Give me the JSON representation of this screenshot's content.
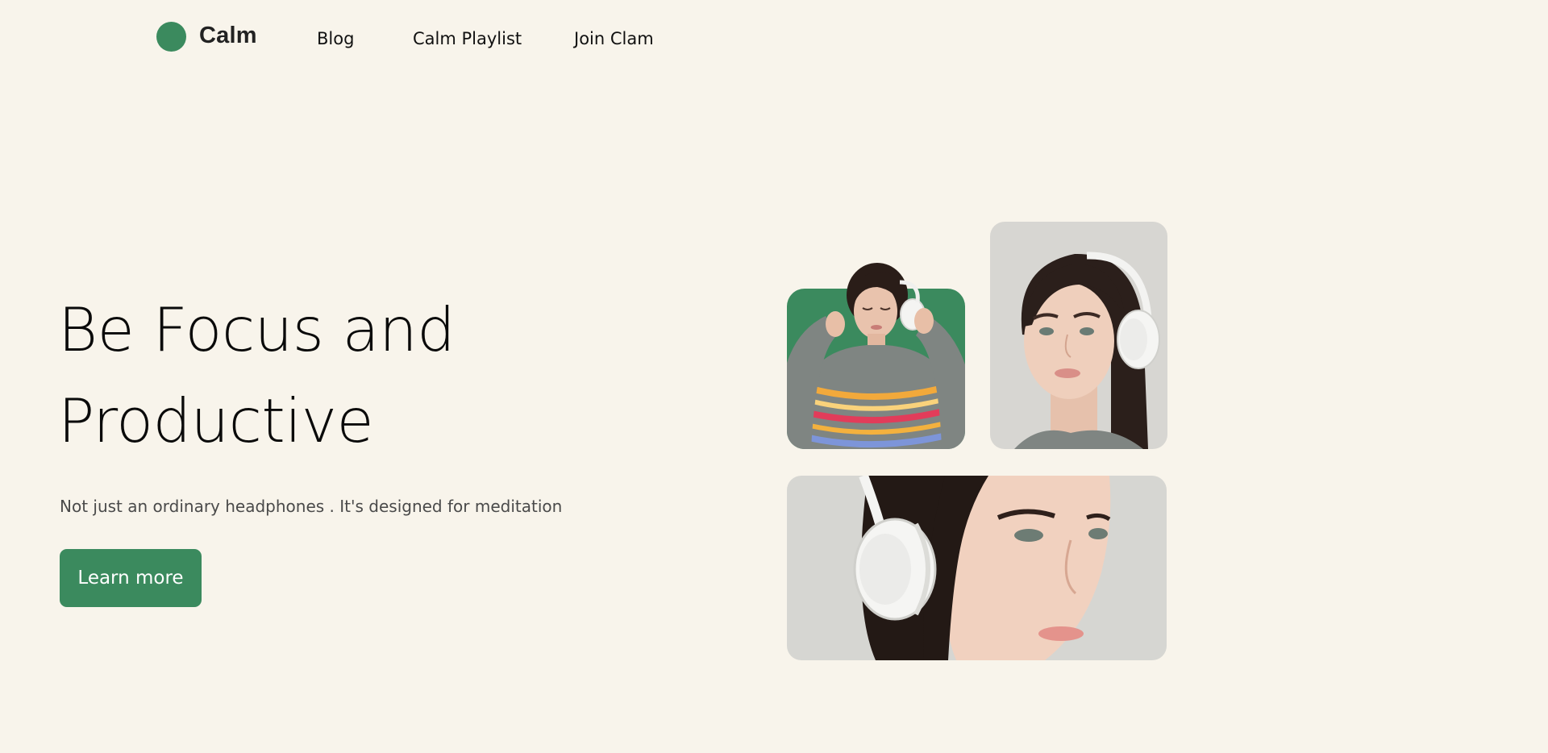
{
  "brand": {
    "name": "Calm",
    "accent": "#3b8a5e",
    "background": "#f8f4eb"
  },
  "nav": {
    "blog": "Blog",
    "playlist": "Calm Playlist",
    "join": "Join Clam"
  },
  "hero": {
    "title_line1": "Be Focus and",
    "title_line2": "Productive",
    "subtitle": "Not just an ordinary headphones . It's designed for meditation",
    "cta_label": "Learn more"
  },
  "images": [
    {
      "name": "woman-with-headphones-green-background"
    },
    {
      "name": "woman-with-white-headphones-portrait"
    },
    {
      "name": "woman-face-closeup-with-headphones"
    }
  ]
}
